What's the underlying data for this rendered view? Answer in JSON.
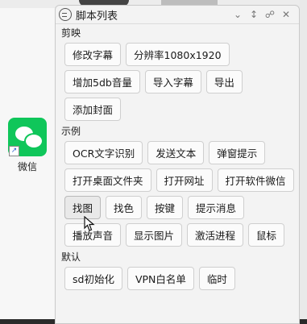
{
  "desktop": {
    "icons": [
      {
        "label": "微信",
        "icon": "wechat-icon"
      }
    ]
  },
  "panel": {
    "title": "脚本列表",
    "icon": "app-icon",
    "controls": [
      "chevron-down-icon",
      "resize-icon",
      "link-icon",
      "close-icon"
    ],
    "sections": [
      {
        "title": "剪映",
        "rows": [
          [
            "修改字幕",
            "分辨率1080x1920"
          ],
          [
            "增加5db音量",
            "导入字幕",
            "导出"
          ],
          [
            "添加封面"
          ]
        ]
      },
      {
        "title": "示例",
        "rows": [
          [
            "OCR文字识别",
            "发送文本",
            "弹窗提示"
          ],
          [
            "打开桌面文件夹",
            "打开网址",
            "打开软件微信"
          ],
          [
            "找图",
            "找色",
            "按键",
            "提示消息"
          ],
          [
            "播放声音",
            "显示图片",
            "激活进程",
            "鼠标"
          ]
        ]
      },
      {
        "title": "默认",
        "rows": [
          [
            "sd初始化",
            "VPN白名单",
            "临时"
          ]
        ]
      }
    ]
  }
}
